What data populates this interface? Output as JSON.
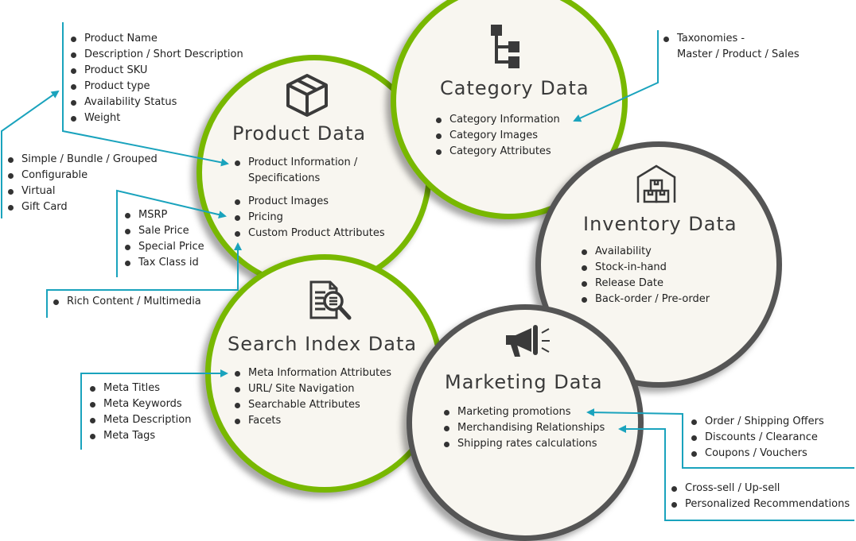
{
  "diagram": {
    "colors": {
      "accent_green": "#78b800",
      "accent_gray": "#555555",
      "connector_teal": "#1aa3bd",
      "circle_fill": "#f8f6f0",
      "text": "#222222"
    },
    "circles": {
      "product": {
        "title": "Product Data",
        "icon": "box-icon",
        "items": [
          "Product Information / Specifications",
          "Product Images",
          "Pricing",
          "Custom Product Attributes"
        ],
        "item_lines": [
          "Product Information /",
          "Specifications"
        ]
      },
      "category": {
        "title": "Category Data",
        "icon": "hierarchy-icon",
        "items": [
          "Category Information",
          "Category Images",
          "Category Attributes"
        ]
      },
      "inventory": {
        "title": "Inventory Data",
        "icon": "warehouse-icon",
        "items": [
          "Availability",
          "Stock-in-hand",
          "Release Date",
          "Back-order / Pre-order"
        ]
      },
      "search": {
        "title": "Search Index Data",
        "icon": "document-search-icon",
        "items": [
          "Meta Information Attributes",
          "URL/ Site Navigation",
          "Searchable Attributes",
          "Facets"
        ]
      },
      "marketing": {
        "title": "Marketing Data",
        "icon": "megaphone-icon",
        "items": [
          "Marketing promotions",
          "Merchandising Relationships",
          "Shipping rates calculations"
        ]
      }
    },
    "callouts": {
      "product_info": [
        "Product Name",
        "Description / Short Description",
        "Product SKU",
        "Product type",
        "Availability Status",
        "Weight"
      ],
      "product_types": [
        "Simple / Bundle / Grouped",
        "Configurable",
        "Virtual",
        "Gift Card"
      ],
      "pricing": [
        "MSRP",
        "Sale Price",
        "Special Price",
        "Tax Class id"
      ],
      "custom_attributes": [
        "Rich Content / Multimedia"
      ],
      "taxonomies": [
        "Taxonomies -",
        "Master / Product / Sales"
      ],
      "meta": [
        "Meta Titles",
        "Meta Keywords",
        "Meta Description",
        "Meta Tags"
      ],
      "promotions": [
        "Order / Shipping Offers",
        "Discounts / Clearance",
        "Coupons / Vouchers"
      ],
      "merchandising": [
        "Cross-sell / Up-sell",
        "Personalized Recommendations"
      ]
    }
  }
}
